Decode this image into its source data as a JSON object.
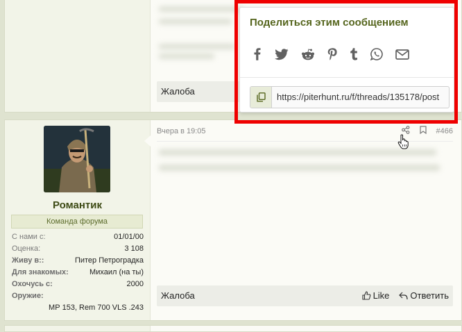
{
  "top_post": {
    "report_label": "Жалоба"
  },
  "post": {
    "date": "Вчера в 19:05",
    "post_number": "#466",
    "user": {
      "name": "Романтик",
      "role": "Команда форума",
      "stats": [
        {
          "label": "С нами с:",
          "value": "01/01/00",
          "bold": false
        },
        {
          "label": "Оценка:",
          "value": "3 108",
          "bold": false
        },
        {
          "label": "Живу в::",
          "value": "Питер Петроградка",
          "bold": true
        },
        {
          "label": "Для знакомых:",
          "value": "Михаил (на ты)",
          "bold": true
        },
        {
          "label": "Охочусь с:",
          "value": "2000",
          "bold": true
        },
        {
          "label": "Оружие:",
          "value": "",
          "bold": true
        }
      ],
      "weapon_value": "МР 153, Rem 700 VLS .243"
    },
    "footer": {
      "report_label": "Жалоба",
      "like_label": "Like",
      "reply_label": "Ответить"
    }
  },
  "share_popup": {
    "title": "Поделиться этим сообщением",
    "networks": [
      "facebook-icon",
      "twitter-icon",
      "reddit-icon",
      "pinterest-icon",
      "tumblr-icon",
      "whatsapp-icon",
      "email-icon"
    ],
    "url": "https://piterhunt.ru/f/threads/135178/post"
  },
  "colors": {
    "accent": "#55651d",
    "highlight_frame": "#ef0000"
  }
}
